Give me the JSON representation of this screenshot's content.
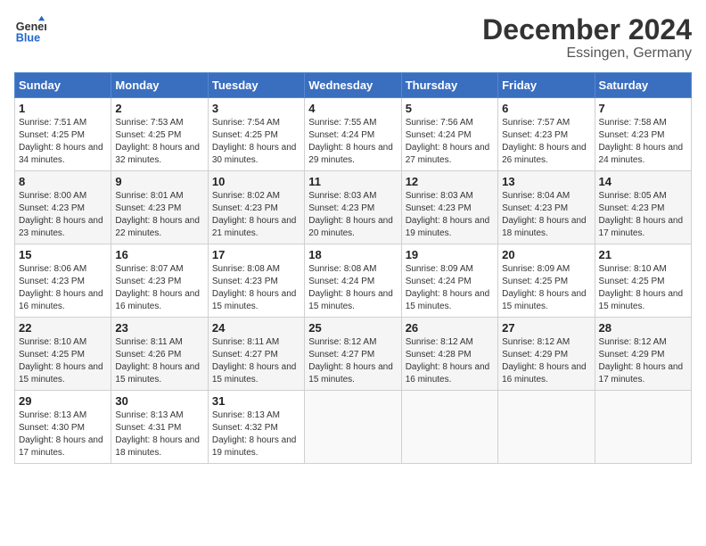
{
  "header": {
    "logo_line1": "General",
    "logo_line2": "Blue",
    "month": "December 2024",
    "location": "Essingen, Germany"
  },
  "days_of_week": [
    "Sunday",
    "Monday",
    "Tuesday",
    "Wednesday",
    "Thursday",
    "Friday",
    "Saturday"
  ],
  "weeks": [
    [
      {
        "day": "1",
        "sunrise": "7:51 AM",
        "sunset": "4:25 PM",
        "daylight": "8 hours and 34 minutes."
      },
      {
        "day": "2",
        "sunrise": "7:53 AM",
        "sunset": "4:25 PM",
        "daylight": "8 hours and 32 minutes."
      },
      {
        "day": "3",
        "sunrise": "7:54 AM",
        "sunset": "4:25 PM",
        "daylight": "8 hours and 30 minutes."
      },
      {
        "day": "4",
        "sunrise": "7:55 AM",
        "sunset": "4:24 PM",
        "daylight": "8 hours and 29 minutes."
      },
      {
        "day": "5",
        "sunrise": "7:56 AM",
        "sunset": "4:24 PM",
        "daylight": "8 hours and 27 minutes."
      },
      {
        "day": "6",
        "sunrise": "7:57 AM",
        "sunset": "4:23 PM",
        "daylight": "8 hours and 26 minutes."
      },
      {
        "day": "7",
        "sunrise": "7:58 AM",
        "sunset": "4:23 PM",
        "daylight": "8 hours and 24 minutes."
      }
    ],
    [
      {
        "day": "8",
        "sunrise": "8:00 AM",
        "sunset": "4:23 PM",
        "daylight": "8 hours and 23 minutes."
      },
      {
        "day": "9",
        "sunrise": "8:01 AM",
        "sunset": "4:23 PM",
        "daylight": "8 hours and 22 minutes."
      },
      {
        "day": "10",
        "sunrise": "8:02 AM",
        "sunset": "4:23 PM",
        "daylight": "8 hours and 21 minutes."
      },
      {
        "day": "11",
        "sunrise": "8:03 AM",
        "sunset": "4:23 PM",
        "daylight": "8 hours and 20 minutes."
      },
      {
        "day": "12",
        "sunrise": "8:03 AM",
        "sunset": "4:23 PM",
        "daylight": "8 hours and 19 minutes."
      },
      {
        "day": "13",
        "sunrise": "8:04 AM",
        "sunset": "4:23 PM",
        "daylight": "8 hours and 18 minutes."
      },
      {
        "day": "14",
        "sunrise": "8:05 AM",
        "sunset": "4:23 PM",
        "daylight": "8 hours and 17 minutes."
      }
    ],
    [
      {
        "day": "15",
        "sunrise": "8:06 AM",
        "sunset": "4:23 PM",
        "daylight": "8 hours and 16 minutes."
      },
      {
        "day": "16",
        "sunrise": "8:07 AM",
        "sunset": "4:23 PM",
        "daylight": "8 hours and 16 minutes."
      },
      {
        "day": "17",
        "sunrise": "8:08 AM",
        "sunset": "4:23 PM",
        "daylight": "8 hours and 15 minutes."
      },
      {
        "day": "18",
        "sunrise": "8:08 AM",
        "sunset": "4:24 PM",
        "daylight": "8 hours and 15 minutes."
      },
      {
        "day": "19",
        "sunrise": "8:09 AM",
        "sunset": "4:24 PM",
        "daylight": "8 hours and 15 minutes."
      },
      {
        "day": "20",
        "sunrise": "8:09 AM",
        "sunset": "4:25 PM",
        "daylight": "8 hours and 15 minutes."
      },
      {
        "day": "21",
        "sunrise": "8:10 AM",
        "sunset": "4:25 PM",
        "daylight": "8 hours and 15 minutes."
      }
    ],
    [
      {
        "day": "22",
        "sunrise": "8:10 AM",
        "sunset": "4:25 PM",
        "daylight": "8 hours and 15 minutes."
      },
      {
        "day": "23",
        "sunrise": "8:11 AM",
        "sunset": "4:26 PM",
        "daylight": "8 hours and 15 minutes."
      },
      {
        "day": "24",
        "sunrise": "8:11 AM",
        "sunset": "4:27 PM",
        "daylight": "8 hours and 15 minutes."
      },
      {
        "day": "25",
        "sunrise": "8:12 AM",
        "sunset": "4:27 PM",
        "daylight": "8 hours and 15 minutes."
      },
      {
        "day": "26",
        "sunrise": "8:12 AM",
        "sunset": "4:28 PM",
        "daylight": "8 hours and 16 minutes."
      },
      {
        "day": "27",
        "sunrise": "8:12 AM",
        "sunset": "4:29 PM",
        "daylight": "8 hours and 16 minutes."
      },
      {
        "day": "28",
        "sunrise": "8:12 AM",
        "sunset": "4:29 PM",
        "daylight": "8 hours and 17 minutes."
      }
    ],
    [
      {
        "day": "29",
        "sunrise": "8:13 AM",
        "sunset": "4:30 PM",
        "daylight": "8 hours and 17 minutes."
      },
      {
        "day": "30",
        "sunrise": "8:13 AM",
        "sunset": "4:31 PM",
        "daylight": "8 hours and 18 minutes."
      },
      {
        "day": "31",
        "sunrise": "8:13 AM",
        "sunset": "4:32 PM",
        "daylight": "8 hours and 19 minutes."
      },
      null,
      null,
      null,
      null
    ]
  ]
}
